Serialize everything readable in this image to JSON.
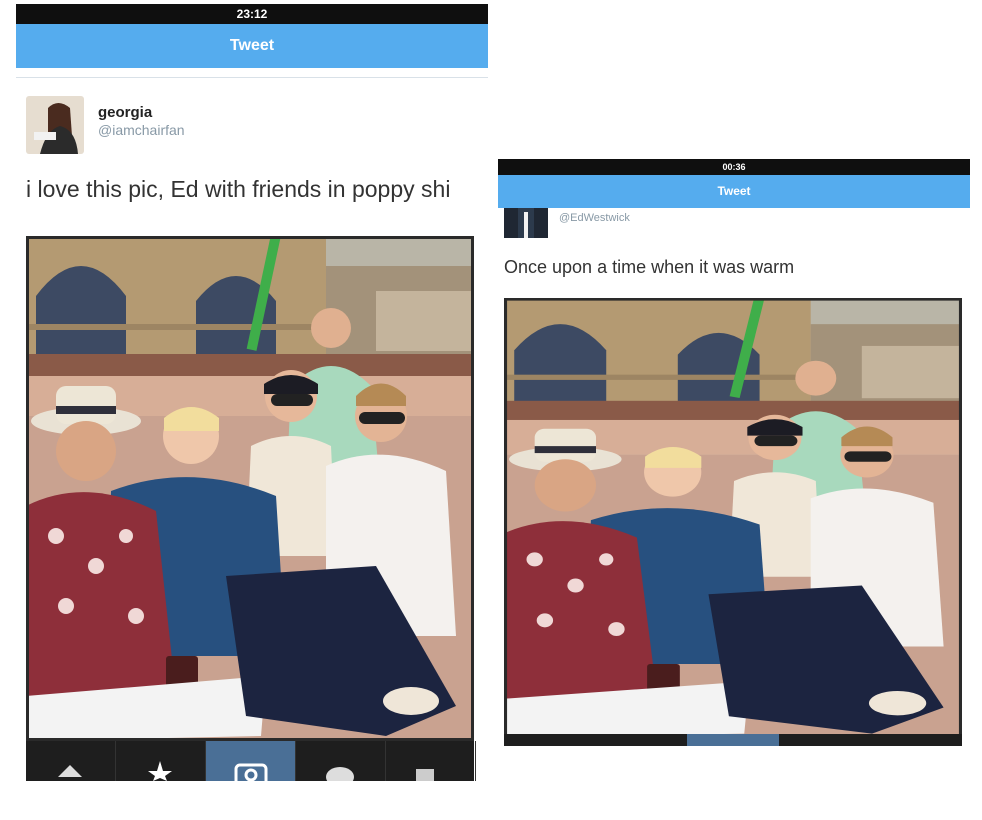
{
  "left_screenshot": {
    "status_bar": {
      "time": "23:12"
    },
    "nav_bar": {
      "title": "Tweet"
    },
    "tweet": {
      "user": {
        "name": "georgia",
        "handle": "@iamchairfan"
      },
      "text": "i love this pic, Ed with friends in poppy shi",
      "photo": {
        "icon": "group-photo"
      }
    },
    "bottom_nav": [
      "home-icon",
      "explore-star-icon",
      "camera-icon",
      "heart-icon",
      "profile-icon"
    ],
    "bottom_nav_active": 2
  },
  "right_screenshot": {
    "status_bar": {
      "time": "00:36"
    },
    "nav_bar": {
      "title": "Tweet"
    },
    "tweet": {
      "user": {
        "handle": "@EdWestwick"
      },
      "text": "Once upon a time when it was warm",
      "photo": {
        "icon": "group-photo"
      }
    }
  },
  "colors": {
    "twitter_blue": "#55acee",
    "status_bar": "#0f0f0f",
    "handle_gray": "#8899a6",
    "active_tab": "#4a6f96"
  }
}
